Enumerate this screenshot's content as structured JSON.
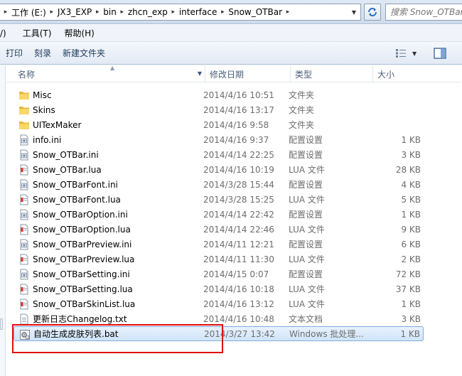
{
  "address_bar": {
    "crumbs": [
      "工作 (E:)",
      "JX3_EXP",
      "bin",
      "zhcn_exp",
      "interface",
      "Snow_OTBar"
    ],
    "search_placeholder": "搜索 Snow_OTBar"
  },
  "menubar": {
    "items": [
      "/)",
      "工具(T)",
      "帮助(H)"
    ]
  },
  "toolbar": {
    "buttons": [
      "打印",
      "刻录",
      "新建文件夹"
    ]
  },
  "columns": {
    "name": "名称",
    "date": "修改日期",
    "type": "类型",
    "size": "大小"
  },
  "files": [
    {
      "name": "Misc",
      "date": "2014/4/16 10:51",
      "type": "文件夹",
      "size": "",
      "icon": "folder-icon"
    },
    {
      "name": "Skins",
      "date": "2014/4/16 13:17",
      "type": "文件夹",
      "size": "",
      "icon": "folder-icon"
    },
    {
      "name": "UITexMaker",
      "date": "2014/4/16 9:58",
      "type": "文件夹",
      "size": "",
      "icon": "folder-icon"
    },
    {
      "name": "info.ini",
      "date": "2014/4/16 9:37",
      "type": "配置设置",
      "size": "1 KB",
      "icon": "ini-file-icon"
    },
    {
      "name": "Snow_OTBar.ini",
      "date": "2014/4/14 22:25",
      "type": "配置设置",
      "size": "3 KB",
      "icon": "ini-file-icon"
    },
    {
      "name": "Snow_OTBar.lua",
      "date": "2014/4/16 10:19",
      "type": "LUA 文件",
      "size": "28 KB",
      "icon": "lua-file-icon"
    },
    {
      "name": "Snow_OTBarFont.ini",
      "date": "2014/3/28 15:44",
      "type": "配置设置",
      "size": "4 KB",
      "icon": "ini-file-icon"
    },
    {
      "name": "Snow_OTBarFont.lua",
      "date": "2014/3/28 15:25",
      "type": "LUA 文件",
      "size": "5 KB",
      "icon": "lua-file-icon"
    },
    {
      "name": "Snow_OTBarOption.ini",
      "date": "2014/4/14 22:42",
      "type": "配置设置",
      "size": "1 KB",
      "icon": "ini-file-icon"
    },
    {
      "name": "Snow_OTBarOption.lua",
      "date": "2014/4/14 22:46",
      "type": "LUA 文件",
      "size": "9 KB",
      "icon": "lua-file-icon"
    },
    {
      "name": "Snow_OTBarPreview.ini",
      "date": "2014/4/11 12:21",
      "type": "配置设置",
      "size": "6 KB",
      "icon": "ini-file-icon"
    },
    {
      "name": "Snow_OTBarPreview.lua",
      "date": "2014/4/11 11:30",
      "type": "LUA 文件",
      "size": "2 KB",
      "icon": "lua-file-icon"
    },
    {
      "name": "Snow_OTBarSetting.ini",
      "date": "2014/4/15 0:07",
      "type": "配置设置",
      "size": "72 KB",
      "icon": "ini-file-icon"
    },
    {
      "name": "Snow_OTBarSetting.lua",
      "date": "2014/4/16 10:18",
      "type": "LUA 文件",
      "size": "37 KB",
      "icon": "lua-file-icon"
    },
    {
      "name": "Snow_OTBarSkinList.lua",
      "date": "2014/4/16 13:12",
      "type": "LUA 文件",
      "size": "1 KB",
      "icon": "lua-file-icon"
    },
    {
      "name": "更新日志Changelog.txt",
      "date": "2014/4/16 10:48",
      "type": "文本文档",
      "size": "3 KB",
      "icon": "text-file-icon"
    },
    {
      "name": "自动生成皮肤列表.bat",
      "date": "2014/3/27 13:42",
      "type": "Windows 批处理...",
      "size": "1 KB",
      "icon": "batch-file-icon",
      "selected": true
    }
  ],
  "colors": {
    "highlight": "#e01010",
    "selection_border": "#84acdd",
    "folder": "#f2c44d"
  }
}
